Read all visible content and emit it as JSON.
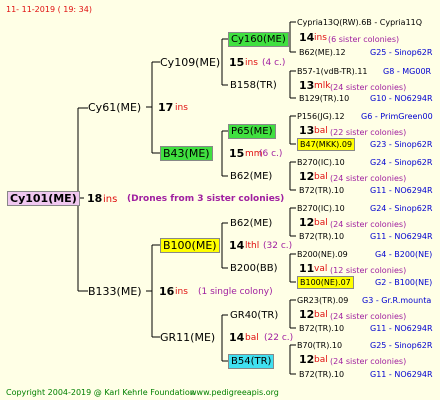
{
  "date": "11- 11-2019 ( 19: 34)",
  "copyright": "Copyright 2004-2019 @ Karl Kehrle Foundation",
  "website": "www.pedigreeapis.org",
  "colors": {
    "text_red": "#e01010",
    "text_blue": "#0000d0",
    "highlight_yellow": "#ffff00",
    "highlight_green": "#40e040",
    "highlight_cyan": "#40e0f0",
    "highlight_pink": "#f0c8f0",
    "background": "#ffffe6"
  },
  "root": {
    "name": "Cy101(ME)",
    "inbreeding": "18",
    "ins": "ins",
    "note": "(Drones from 3 sister colonies)"
  },
  "gen1": {
    "top": {
      "name": "Cy61(ME)",
      "inbreeding": "17",
      "ins": "ins"
    },
    "bottom": {
      "name": "B133(ME)",
      "inbreeding": "16",
      "ins": "ins",
      "note": "(1 single colony)"
    }
  },
  "gen2": {
    "a": {
      "name": "Cy109(ME)",
      "inbreeding": "15",
      "ins": "ins",
      "note": "(4 c.)"
    },
    "b": {
      "name": "B43(ME)",
      "inbreeding": "15",
      "ins": "mm",
      "note": "(6 c.)"
    },
    "c": {
      "name": "B100(ME)",
      "inbreeding": "14",
      "ins": "lthl",
      "note": "(32 c.)"
    },
    "d": {
      "name": "GR11(ME)",
      "inbreeding": "14",
      "ins": "bal",
      "note": "(22 c.)"
    }
  },
  "gen3": {
    "a1": "Cy160(ME)",
    "a2": "B158(TR)",
    "b1": "P65(ME)",
    "b2": "B62(ME)",
    "c1": "B62(ME)",
    "c2": "B200(BB)",
    "d1": "GR40(TR)",
    "d2": "B54(TR)"
  },
  "gen4": [
    {
      "top": "Cypria13Q(RW).6B - Cypria11Q",
      "mid_num": "14",
      "mid_ins": "ins",
      "mid_note": "(6 sister colonies)",
      "bottom": "B62(ME).12",
      "bottom_code": "G25 - Sinop62R"
    },
    {
      "top": "B57-1(vdB-TR).11",
      "top_code": "G8 - MG00R",
      "mid_num": "13",
      "mid_ins": "mlk",
      "mid_note": "(24 sister colonies)",
      "bottom": "B129(TR).10",
      "bottom_code": "G10 - NO6294R"
    },
    {
      "top": "P156(JG).12",
      "top_code": "G6 - PrimGreen00",
      "mid_num": "13",
      "mid_ins": "bal",
      "mid_note": "(22 sister colonies)",
      "bottom": "B47(MKK).09",
      "bottom_code": "G23 - Sinop62R"
    },
    {
      "top": "B270(IC).10",
      "top_code": "G24 - Sinop62R",
      "mid_num": "12",
      "mid_ins": "bal",
      "mid_note": "(24 sister colonies)",
      "bottom": "B72(TR).10",
      "bottom_code": "G11 - NO6294R"
    },
    {
      "top": "B270(IC).10",
      "top_code": "G24 - Sinop62R",
      "mid_num": "12",
      "mid_ins": "bal",
      "mid_note": "(24 sister colonies)",
      "bottom": "B72(TR).10",
      "bottom_code": "G11 - NO6294R"
    },
    {
      "top": "B200(NE).09",
      "top_code": "G4 - B200(NE)",
      "mid_num": "11",
      "mid_ins": "val",
      "mid_note": "(12 sister colonies)",
      "bottom": "B100(NE).07",
      "bottom_code": "G2 - B100(NE)"
    },
    {
      "top": "GR23(TR).09",
      "top_code": "G3 - Gr.R.mounta",
      "mid_num": "12",
      "mid_ins": "bal",
      "mid_note": "(24 sister colonies)",
      "bottom": "B72(TR).10",
      "bottom_code": "G11 - NO6294R"
    },
    {
      "top": "B70(TR).10",
      "top_code": "G25 - Sinop62R",
      "mid_num": "12",
      "mid_ins": "bal",
      "mid_note": "(24 sister colonies)",
      "bottom": "B72(TR).10",
      "bottom_code": "G11 - NO6294R"
    }
  ]
}
